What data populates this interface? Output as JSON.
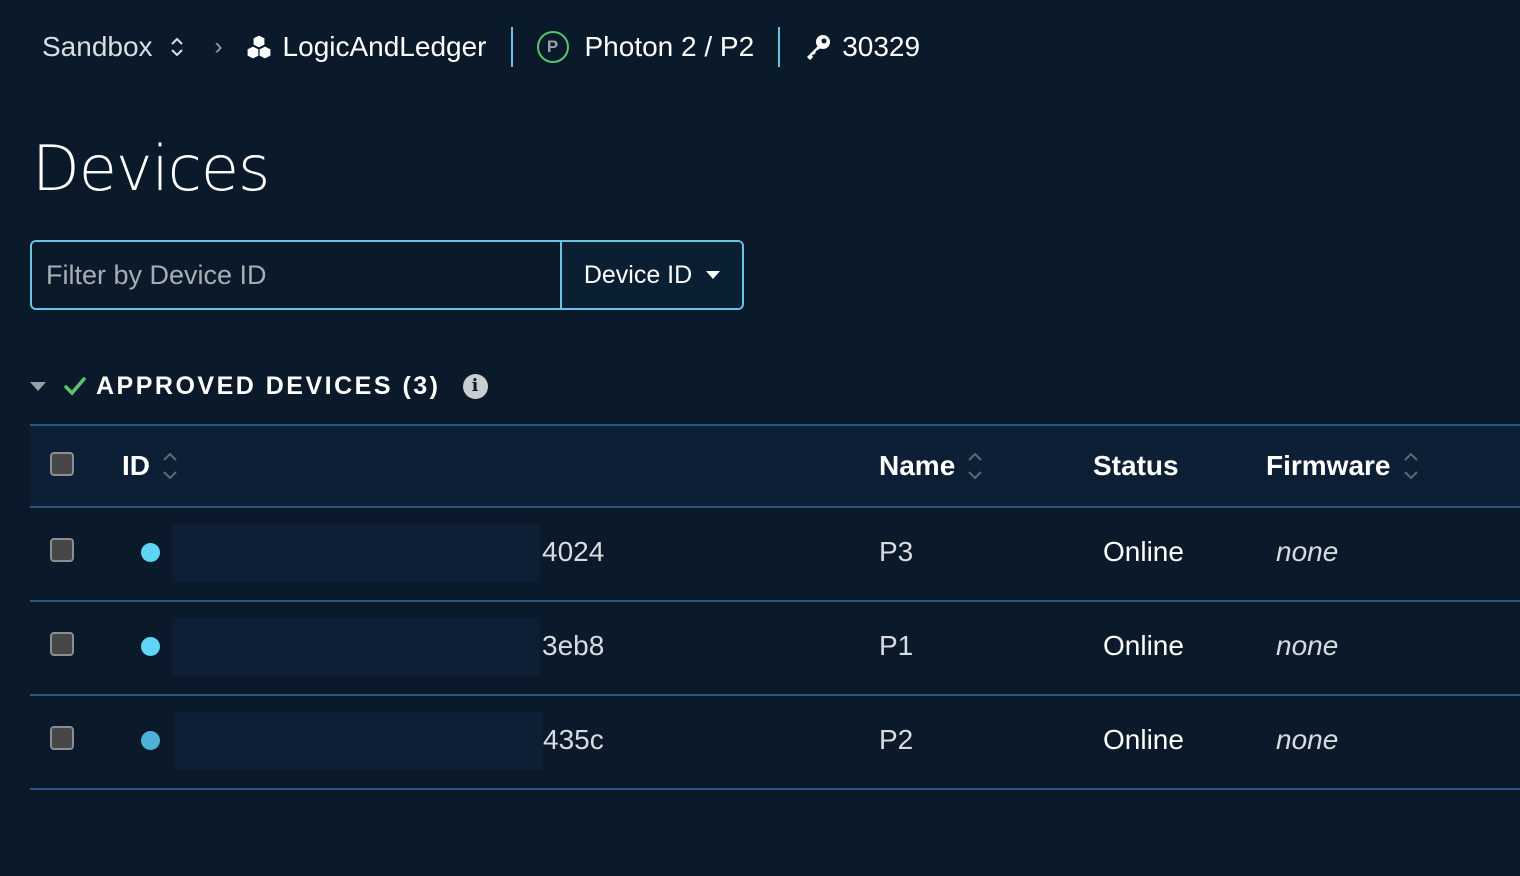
{
  "topbar": {
    "sandbox": "Sandbox",
    "separator": "›",
    "org": "LogicAndLedger",
    "platform_badge": "P",
    "platform": "Photon 2 / P2",
    "product_id": "30329",
    "icons": {
      "switcher": "up-down-chevron-icon",
      "org": "cubes-icon",
      "key": "key-icon"
    }
  },
  "page": {
    "title": "Devices"
  },
  "filter": {
    "placeholder": "Filter by Device ID",
    "value": "",
    "field_select": "Device ID"
  },
  "section": {
    "title": "APPROVED DEVICES (3)",
    "expanded": true
  },
  "table": {
    "headers": {
      "id": "ID",
      "name": "Name",
      "status": "Status",
      "firmware": "Firmware"
    },
    "rows": [
      {
        "id_suffix": "4024",
        "name": "P3",
        "status": "Online",
        "firmware": "none",
        "dot_color": "#5fd5f5"
      },
      {
        "id_suffix": "3eb8",
        "name": "P1",
        "status": "Online",
        "firmware": "none",
        "dot_color": "#5fd5f5"
      },
      {
        "id_suffix": "435c",
        "name": "P2",
        "status": "Online",
        "firmware": "none",
        "dot_color": "#4db3d6"
      }
    ]
  },
  "colors": {
    "background": "#0a1a2b",
    "accent": "#6ac3e6",
    "success": "#58c46d",
    "divider": "#2a5683"
  }
}
